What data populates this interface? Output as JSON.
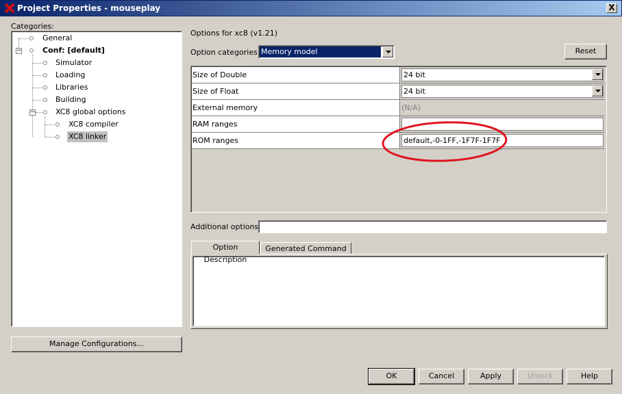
{
  "window": {
    "title": "Project Properties - mouseplay",
    "close_label": "X"
  },
  "categories": {
    "label": "Categories:",
    "items": [
      {
        "label": "General"
      },
      {
        "label": "Conf: [default]"
      },
      {
        "label": "Simulator"
      },
      {
        "label": "Loading"
      },
      {
        "label": "Libraries"
      },
      {
        "label": "Building"
      },
      {
        "label": "XC8 global options"
      },
      {
        "label": "XC8 compiler"
      },
      {
        "label": "XC8 linker"
      }
    ],
    "manage_button": "Manage Configurations..."
  },
  "options": {
    "header": "Options for xc8 (v1.21)",
    "category_label": "Option categories:",
    "category_value": "Memory model",
    "reset_button": "Reset",
    "properties": [
      {
        "name": "Size of Double",
        "value": "24 bit"
      },
      {
        "name": "Size of Float",
        "value": "24 bit"
      },
      {
        "name": "External memory",
        "value": "(N/A)"
      },
      {
        "name": "RAM ranges",
        "value": ""
      },
      {
        "name": "ROM ranges",
        "value": "default,-0-1FF,-1F7F-1F7F"
      }
    ],
    "additional_label": "Additional options:",
    "additional_value": "",
    "tabs": [
      {
        "label": "Option Description"
      },
      {
        "label": "Generated Command Line"
      }
    ]
  },
  "annotation_color": "#e0141e",
  "buttons": {
    "ok": "OK",
    "cancel": "Cancel",
    "apply": "Apply",
    "unlock": "Unlock",
    "help": "Help"
  }
}
